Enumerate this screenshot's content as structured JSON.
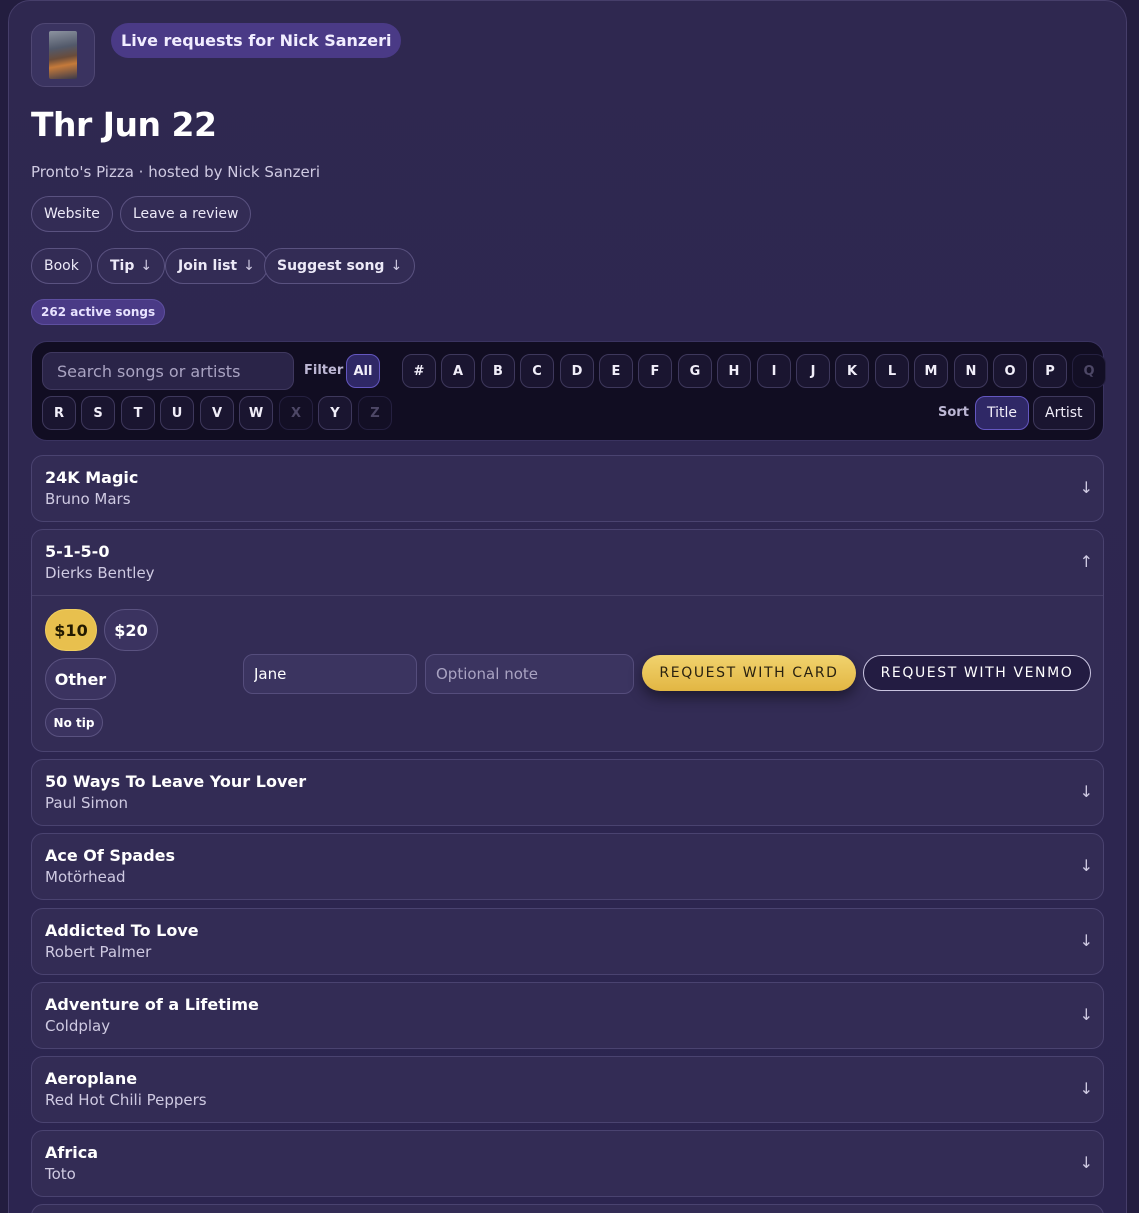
{
  "header": {
    "live_label": "Live requests for Nick Sanzeri",
    "date_title": "Thr Jun 22",
    "venue_line": "Pronto's Pizza · hosted by Nick Sanzeri"
  },
  "links": {
    "website": "Website",
    "review": "Leave a review"
  },
  "actions": {
    "book": "Book",
    "tip": "Tip",
    "join_list": "Join list",
    "suggest_song": "Suggest song",
    "arrow_glyph": "↓"
  },
  "count_badge": "262 active songs",
  "filter_bar": {
    "search_placeholder": "Search songs or artists",
    "filter_label": "Filter",
    "sort_label": "Sort",
    "letters": [
      "All",
      "#",
      "A",
      "B",
      "C",
      "D",
      "E",
      "F",
      "G",
      "H",
      "I",
      "J",
      "K",
      "L",
      "M",
      "N",
      "O",
      "P",
      "Q",
      "R",
      "S",
      "T",
      "U",
      "V",
      "W",
      "X",
      "Y",
      "Z"
    ],
    "active_letter": "All",
    "disabled_letters": [
      "Q",
      "X",
      "Z"
    ],
    "sort_options": [
      "Title",
      "Artist"
    ],
    "active_sort": "Title"
  },
  "songs": [
    {
      "title": "24K Magic",
      "artist": "Bruno Mars",
      "toggle": "↓"
    },
    {
      "title": "5-1-5-0",
      "artist": "Dierks Bentley",
      "toggle": "↑"
    },
    {
      "title": "50 Ways To Leave Your Lover",
      "artist": "Paul Simon",
      "toggle": "↓"
    },
    {
      "title": "Ace Of Spades",
      "artist": "Motörhead",
      "toggle": "↓"
    },
    {
      "title": "Addicted To Love",
      "artist": "Robert Palmer",
      "toggle": "↓"
    },
    {
      "title": "Adventure of a Lifetime",
      "artist": "Coldplay",
      "toggle": "↓"
    },
    {
      "title": "Aeroplane",
      "artist": "Red Hot Chili Peppers",
      "toggle": "↓"
    },
    {
      "title": "Africa",
      "artist": "Toto",
      "toggle": "↓"
    }
  ],
  "request_panel": {
    "tip_10": "$10",
    "tip_20": "$20",
    "tip_other": "Other",
    "no_tip": "No tip",
    "selected_tip": "$10",
    "name_value": "Jane",
    "note_placeholder": "Optional note",
    "card_button": "REQUEST WITH CARD",
    "venmo_button": "REQUEST WITH VENMO"
  },
  "colors": {
    "background": "#231d3f",
    "card": "#2f2850",
    "accent_purple": "#4a3a86",
    "gold": "#e8c04e"
  }
}
